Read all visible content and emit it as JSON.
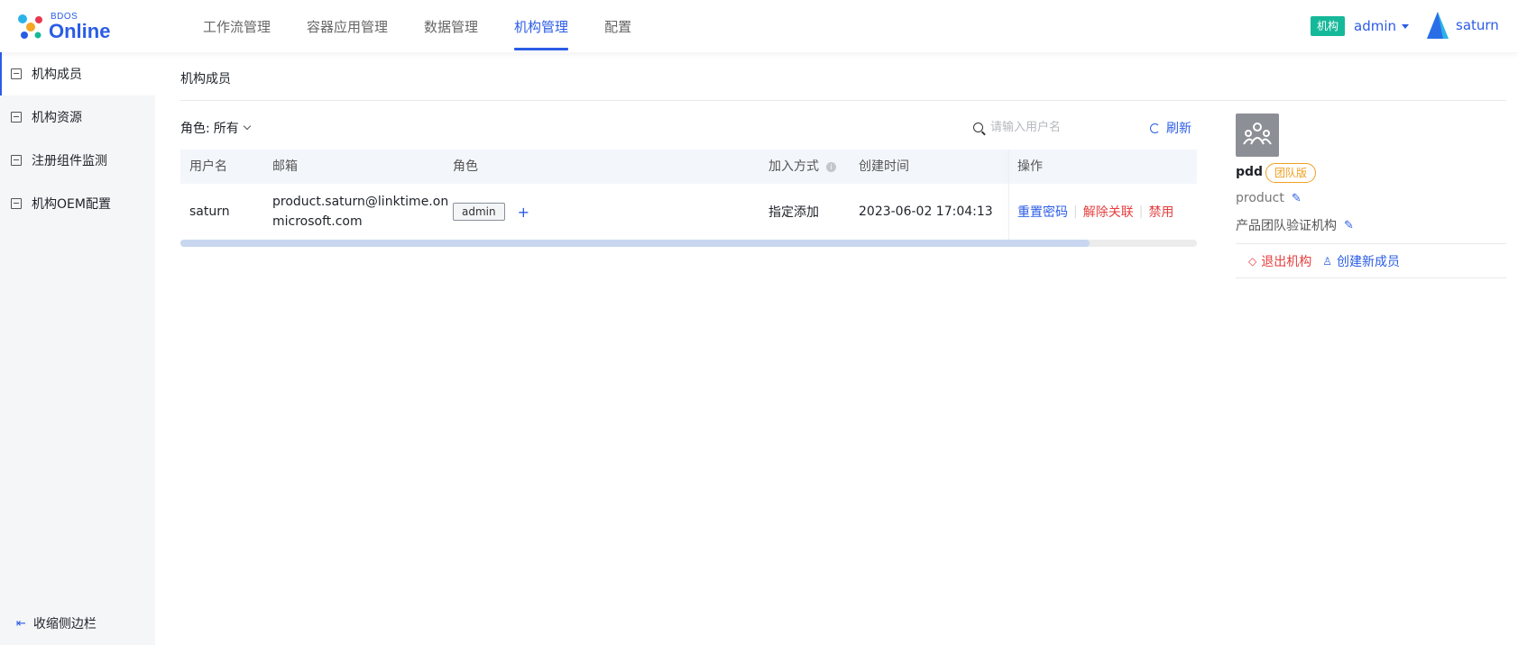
{
  "brand": {
    "small": "BDOS",
    "big": "Online"
  },
  "nav": {
    "items": [
      {
        "label": "工作流管理"
      },
      {
        "label": "容器应用管理"
      },
      {
        "label": "数据管理"
      },
      {
        "label": "机构管理",
        "active": true
      },
      {
        "label": "配置"
      }
    ]
  },
  "header": {
    "org_badge": "机构",
    "org_user": "admin",
    "user_name": "saturn"
  },
  "sidebar": {
    "items": [
      {
        "label": "机构成员",
        "icon": "member-card-icon",
        "active": true
      },
      {
        "label": "机构资源",
        "icon": "document-icon"
      },
      {
        "label": "注册组件监测",
        "icon": "monitor-list-icon"
      },
      {
        "label": "机构OEM配置",
        "icon": "config-panel-icon"
      }
    ],
    "collapse_label": "收缩侧边栏"
  },
  "main": {
    "title": "机构成员",
    "filter_label": "角色:",
    "filter_value": "所有",
    "search_placeholder": "请输入用户名",
    "refresh_label": "刷新"
  },
  "table": {
    "columns": [
      "用户名",
      "邮箱",
      "角色",
      "加入方式",
      "创建时间",
      "操作"
    ],
    "rows": [
      {
        "username": "saturn",
        "email_line1": "product.saturn@linktime.on",
        "email_line2": "microsoft.com",
        "role": "admin",
        "join_method": "指定添加",
        "created": "2023-06-02 17:04:13",
        "ops": [
          "重置密码",
          "解除关联",
          "禁用"
        ]
      }
    ]
  },
  "org_panel": {
    "name": "pdd",
    "edition": "团队版",
    "field1": "product",
    "field2": "产品团队验证机构",
    "leave_label": "退出机构",
    "create_label": "创建新成员"
  },
  "colors": {
    "accent": "#2b5ce6",
    "badge_green": "#16b89a",
    "danger": "#e53e3e",
    "edition_orange": "#f0a020"
  }
}
